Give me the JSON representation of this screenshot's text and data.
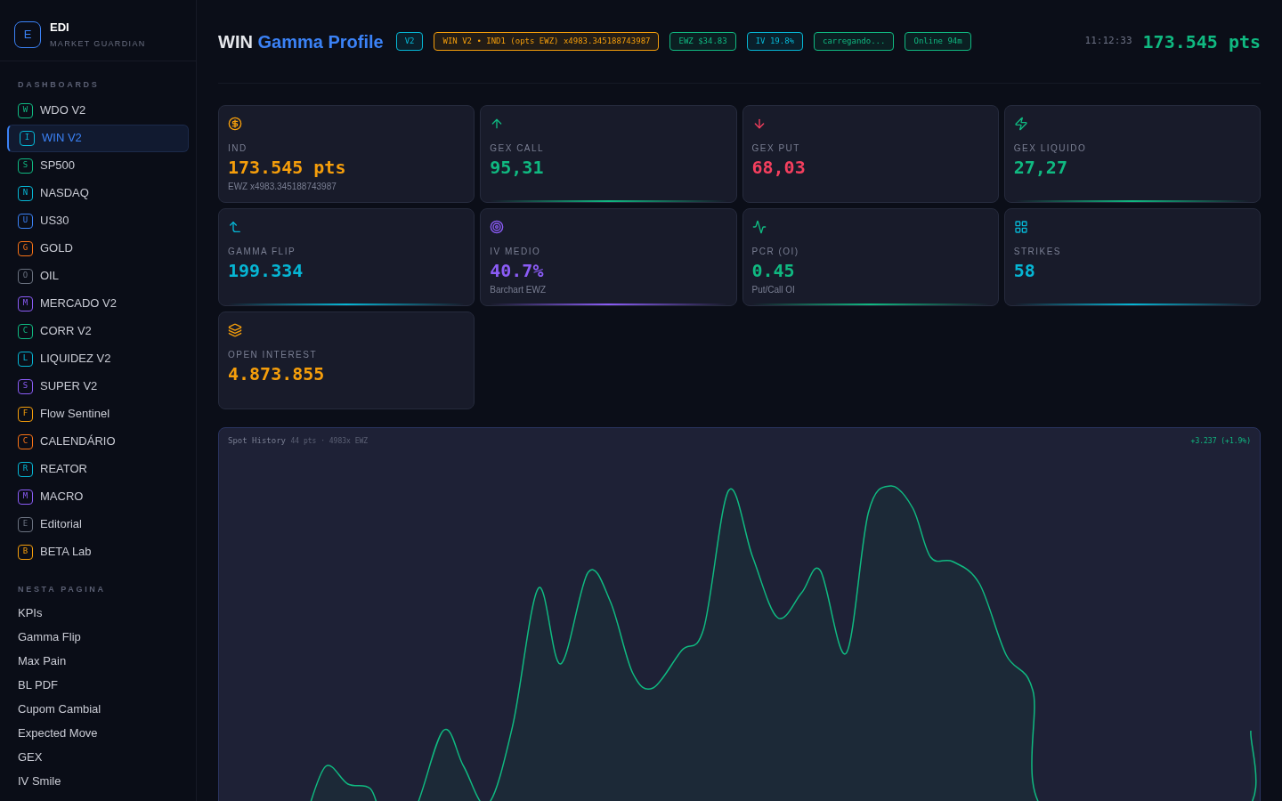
{
  "brand": {
    "logo": "E",
    "name": "EDI",
    "subtitle": "MARKET GUARDIAN"
  },
  "sidebar": {
    "sections": [
      {
        "title": "DASHBOARDS",
        "items": [
          {
            "badge": "W",
            "label": "WDO V2",
            "color": "#10b981",
            "selected": false
          },
          {
            "badge": "I",
            "label": "WIN V2",
            "color": "#06b6d4",
            "selected": true
          },
          {
            "badge": "S",
            "label": "SP500",
            "color": "#10b981",
            "selected": false
          },
          {
            "badge": "N",
            "label": "NASDAQ",
            "color": "#06b6d4",
            "selected": false
          },
          {
            "badge": "U",
            "label": "US30",
            "color": "#3b82f6",
            "selected": false
          },
          {
            "badge": "G",
            "label": "GOLD",
            "color": "#f97316",
            "selected": false
          },
          {
            "badge": "O",
            "label": "OIL",
            "color": "#6b7280",
            "selected": false
          },
          {
            "badge": "M",
            "label": "MERCADO V2",
            "color": "#8b5cf6",
            "selected": false
          },
          {
            "badge": "C",
            "label": "CORR V2",
            "color": "#10b981",
            "selected": false
          },
          {
            "badge": "L",
            "label": "LIQUIDEZ V2",
            "color": "#06b6d4",
            "selected": false
          },
          {
            "badge": "S",
            "label": "SUPER V2",
            "color": "#8b5cf6",
            "selected": false
          },
          {
            "badge": "F",
            "label": "Flow Sentinel",
            "color": "#f59e0b",
            "selected": false
          },
          {
            "badge": "C",
            "label": "CALENDÁRIO",
            "color": "#f97316",
            "selected": false
          },
          {
            "badge": "R",
            "label": "REATOR",
            "color": "#06b6d4",
            "selected": false
          },
          {
            "badge": "M",
            "label": "MACRO",
            "color": "#8b5cf6",
            "selected": false
          },
          {
            "badge": "E",
            "label": "Editorial",
            "color": "#6b7280",
            "selected": false
          },
          {
            "badge": "B",
            "label": "BETA Lab",
            "color": "#f59e0b",
            "selected": false
          }
        ]
      },
      {
        "title": "NESTA PAGINA",
        "items": [
          {
            "label": "KPIs"
          },
          {
            "label": "Gamma Flip"
          },
          {
            "label": "Max Pain"
          },
          {
            "label": "BL PDF"
          },
          {
            "label": "Cupom Cambial"
          },
          {
            "label": "Expected Move"
          },
          {
            "label": "GEX"
          },
          {
            "label": "IV Smile"
          }
        ]
      }
    ]
  },
  "header": {
    "title_prefix": "WIN",
    "title": "Gamma Profile",
    "badges": [
      {
        "text": "V2",
        "color": "#06b6d4"
      },
      {
        "text": "WIN V2 • IND1 (opts EWZ) x4983.345188743987",
        "color": "#f59e0b"
      },
      {
        "text": "EWZ $34.83",
        "color": "#10b981"
      },
      {
        "text": "IV 19.8%",
        "color": "#06b6d4"
      },
      {
        "text": "carregando...",
        "color": "#10b981"
      },
      {
        "text": "Online 94m",
        "color": "#10b981"
      }
    ],
    "time": "11:12:33",
    "price": "173.545 pts"
  },
  "cards": [
    {
      "kind": "coin",
      "label": "IND",
      "value": "173.545 pts",
      "sub": "EWZ x4983.345188743987",
      "color": "#f59e0b"
    },
    {
      "kind": "up",
      "label": "GEX CALL",
      "value": "95,31",
      "color": "#10b981",
      "accent": true
    },
    {
      "kind": "down",
      "label": "GEX PUT",
      "value": "68,03",
      "color": "#f43f5e"
    },
    {
      "kind": "bolt",
      "label": "GEX LIQUIDO",
      "value": "27,27",
      "color": "#10b981",
      "accent": true
    },
    {
      "kind": "flip",
      "label": "GAMMA FLIP",
      "value": "199.334",
      "color": "#06b6d4",
      "accent": true
    },
    {
      "kind": "target",
      "label": "IV MEDIO",
      "value": "40.7%",
      "sub": "Barchart EWZ",
      "color": "#8b5cf6",
      "accent": true
    },
    {
      "kind": "pulse",
      "label": "PCR (OI)",
      "value": "0.45",
      "sub": "Put/Call OI",
      "color": "#10b981",
      "accent": true
    },
    {
      "kind": "grid",
      "label": "STRIKES",
      "value": "58",
      "color": "#06b6d4",
      "accent": true
    },
    {
      "kind": "layers",
      "label": "OPEN INTEREST",
      "value": "4.873.855",
      "color": "#f59e0b"
    }
  ],
  "spot_history": {
    "title": "Spot History",
    "meta": "44 pts · 4983x EWZ",
    "change": "+3.237 (+1.9%)"
  }
}
